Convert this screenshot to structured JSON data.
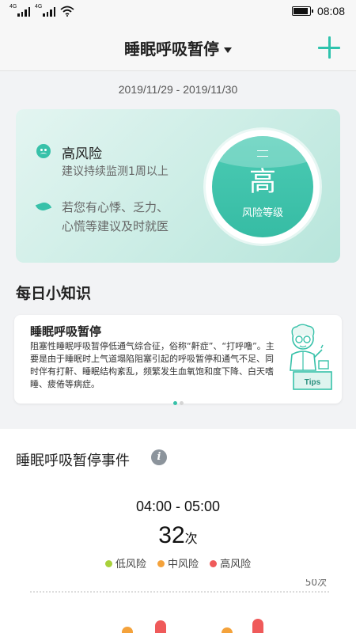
{
  "status_bar": {
    "network_1": "4G",
    "network_2": "4G",
    "time": "08:08",
    "battery_level": 0.9
  },
  "header": {
    "title": "睡眠呼吸暂停"
  },
  "date_range": "2019/11/29 - 2019/11/30",
  "risk": {
    "level": "高风险",
    "monitor_advice": "建议持续监测1周以上",
    "medical_advice_line1": "若您有心悸、乏力、",
    "medical_advice_line2": "心慌等建议及时就医",
    "badge_value": "高",
    "badge_label": "风险等级"
  },
  "daily_tips": {
    "section_title": "每日小知识",
    "title": "睡眠呼吸暂停",
    "body": "阻塞性睡眠呼吸暂停低通气综合征，俗称“鼾症”、“打呼噜”。主要是由于睡眠时上气道塌陷阻塞引起的呼吸暂停和通气不足、同时伴有打鼾、睡眠结构紊乱，频繁发生血氧饱和度下降、白天嗜睡、疲倦等病症。",
    "illustration_label": "Tips",
    "page_index": 0,
    "page_count": 2
  },
  "events": {
    "title": "睡眠呼吸暂停事件",
    "time_range": "04:00 - 05:00",
    "count": "32",
    "count_unit": "次",
    "legend": [
      {
        "label": "低风险",
        "color": "#a8d13a"
      },
      {
        "label": "中风险",
        "color": "#f4a23b"
      },
      {
        "label": "高风险",
        "color": "#ef5a5a"
      }
    ]
  },
  "chart_data": {
    "type": "bar",
    "ylabel": "",
    "y_tick_labels": [
      "50次"
    ],
    "ylim": [
      0,
      50
    ],
    "series": [
      {
        "values": [
          6,
          14,
          5,
          16
        ]
      }
    ],
    "series_colors": [
      "#f4a23b",
      "#ef5a5a",
      "#f4a23b",
      "#ef5a5a"
    ],
    "note": ""
  }
}
